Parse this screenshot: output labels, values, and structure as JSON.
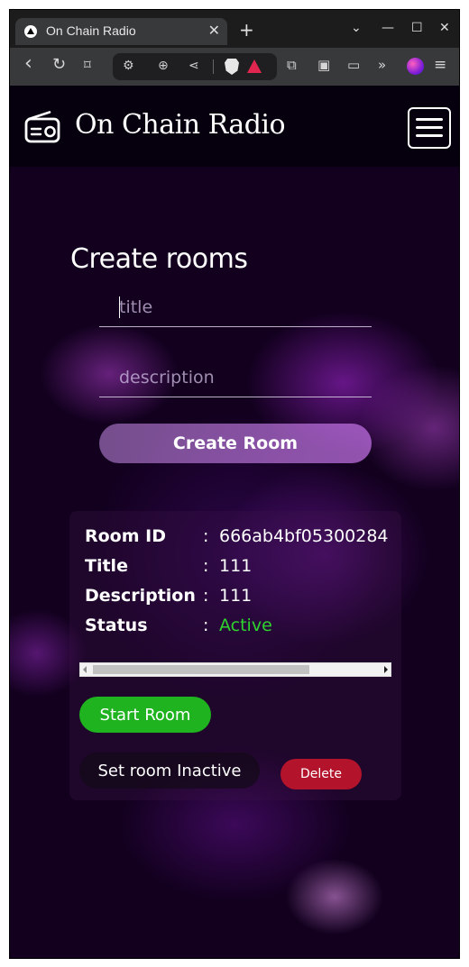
{
  "browser": {
    "tab_title": "On Chain Radio",
    "tab_close": "✕",
    "new_tab": "+",
    "tab_list": "⌄",
    "minimize": "—",
    "maximize": "☐",
    "close": "✕"
  },
  "toolbar": {
    "back": "‹",
    "reload": "↻",
    "bookmark": "⌑",
    "site_info": "⚙",
    "zoom": "⊕",
    "share": "⋖",
    "extensions": "⧉",
    "sidebar": "▣",
    "wallet": "▭",
    "more": "»",
    "menu": "≡"
  },
  "nav": {
    "brand_title": "On Chain Radio",
    "brand_icon": "radio-icon",
    "menu_icon": "hamburger-icon"
  },
  "create": {
    "heading": "Create rooms",
    "title_placeholder": "title",
    "description_placeholder": "description",
    "submit_label": "Create Room"
  },
  "room": {
    "rows": [
      {
        "label": "Room ID",
        "colon": ":",
        "value": "666ab4bf05300284"
      },
      {
        "label": "Title",
        "colon": ":",
        "value": "111"
      },
      {
        "label": "Description",
        "colon": ":",
        "value": "111"
      },
      {
        "label": "Status",
        "colon": ":",
        "value": "Active"
      }
    ],
    "start_label": "Start Room",
    "inactive_label": "Set room Inactive",
    "delete_label": "Delete",
    "status_color": "#2ed42e"
  }
}
